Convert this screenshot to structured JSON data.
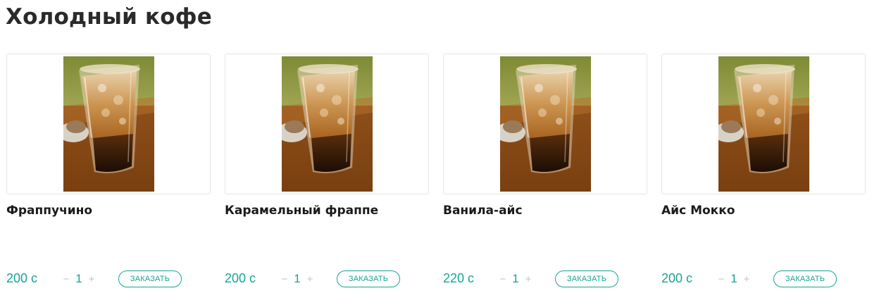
{
  "section": {
    "title": "Холодный кофе"
  },
  "products": [
    {
      "name": "Фраппучино",
      "price": "200 с",
      "quantity": "1",
      "minus": "−",
      "plus": "+",
      "order_label": "ЗАКАЗАТЬ"
    },
    {
      "name": "Карамельный фраппе",
      "price": "200 с",
      "quantity": "1",
      "minus": "−",
      "plus": "+",
      "order_label": "ЗАКАЗАТЬ"
    },
    {
      "name": "Ванила-айс",
      "price": "220 с",
      "quantity": "1",
      "minus": "−",
      "plus": "+",
      "order_label": "ЗАКАЗАТЬ"
    },
    {
      "name": "Айс Мокко",
      "price": "200 с",
      "quantity": "1",
      "minus": "−",
      "plus": "+",
      "order_label": "ЗАКАЗАТЬ"
    }
  ],
  "colors": {
    "accent": "#17a592",
    "text": "#1b1b1b",
    "border": "#e6e6e6"
  }
}
